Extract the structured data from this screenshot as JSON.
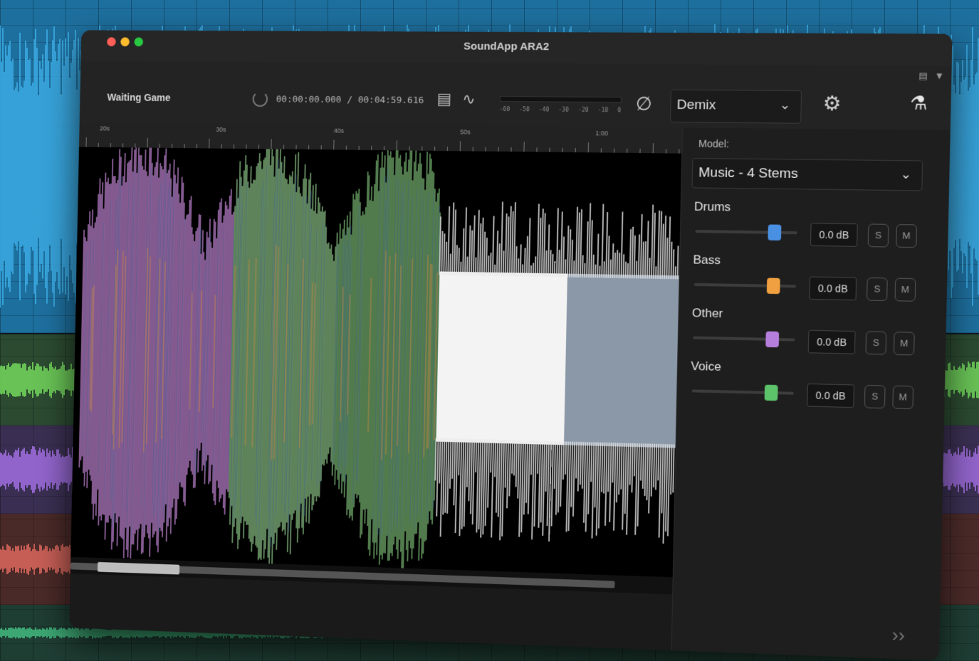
{
  "window": {
    "title": "SoundApp ARA2"
  },
  "toolbar": {
    "song_title": "Waiting Game",
    "current_time": "00:00:00.000",
    "total_time": "/ 00:04:59.616",
    "meter_ticks": [
      "-60",
      "-50",
      "-40",
      "-30",
      "-20",
      "-10",
      "0"
    ],
    "mode_value": "Demix"
  },
  "timeline": {
    "labels": [
      "20s",
      "30s",
      "40s",
      "50s",
      "1:00"
    ]
  },
  "panel": {
    "model_label": "Model:",
    "model_value": "Music - 4 Stems",
    "stems": [
      {
        "name": "Drums",
        "gain": "0.0 dB",
        "level": 0.78,
        "color": "#4a90e2",
        "solo": "S",
        "mute": "M"
      },
      {
        "name": "Bass",
        "gain": "0.0 dB",
        "level": 0.78,
        "color": "#f0a040",
        "solo": "S",
        "mute": "M"
      },
      {
        "name": "Other",
        "gain": "0.0 dB",
        "level": 0.78,
        "color": "#b57edc",
        "solo": "S",
        "mute": "M"
      },
      {
        "name": "Voice",
        "gain": "0.0 dB",
        "level": 0.78,
        "color": "#5cc36a",
        "solo": "S",
        "mute": "M"
      }
    ]
  },
  "colors": {
    "accent_blue": "#4a90e2",
    "accent_orange": "#f0a040",
    "accent_purple": "#b57edc",
    "accent_green": "#5cc36a"
  }
}
